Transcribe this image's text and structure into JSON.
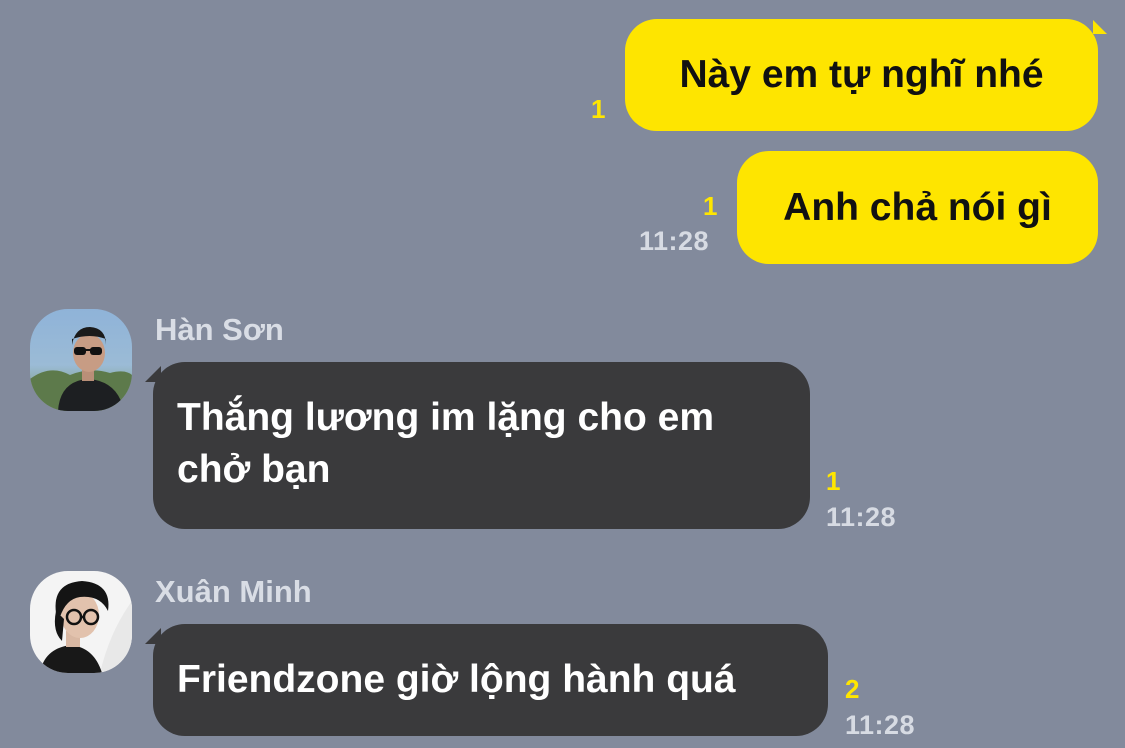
{
  "colors": {
    "background": "#828a9c",
    "outgoing_bubble": "#fee500",
    "incoming_bubble": "#3a3a3c",
    "unread_count": "#ffe600"
  },
  "messages": [
    {
      "direction": "outgoing",
      "text": "Này em tự nghĩ nhé",
      "unread": "1",
      "time": ""
    },
    {
      "direction": "outgoing",
      "text": "Anh chả nói gì",
      "unread": "1",
      "time": "11:28"
    },
    {
      "direction": "incoming",
      "sender": "Hàn Sơn",
      "avatar_icon": "user-avatar-icon",
      "text": "Thắng lương im lặng cho em chở bạn",
      "unread": "1",
      "time": "11:28"
    },
    {
      "direction": "incoming",
      "sender": "Xuân Minh",
      "avatar_icon": "user-avatar-icon",
      "text": "Friendzone giờ lộng hành quá",
      "unread": "2",
      "time": "11:28"
    }
  ]
}
